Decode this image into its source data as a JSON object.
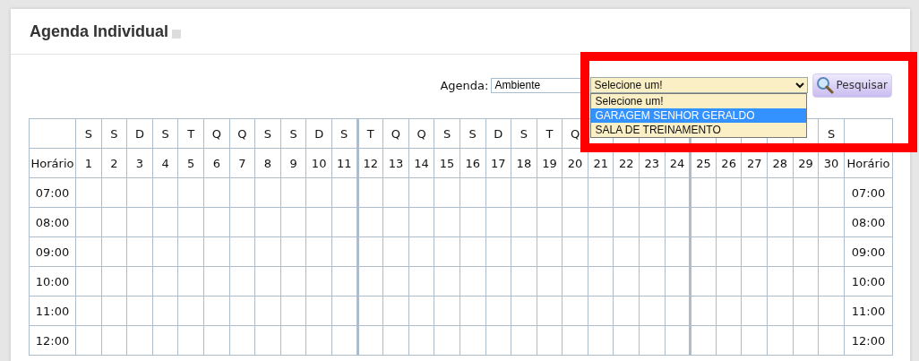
{
  "title": "Agenda Individual",
  "filter": {
    "label": "Agenda:",
    "type_value": "Ambiente",
    "select_value": "Selecione um!",
    "expanded": true,
    "options": [
      {
        "label": "Selecione um!",
        "selected": false
      },
      {
        "label": "GARAGEM SENHOR GERALDO",
        "selected": true
      },
      {
        "label": "SALA DE TREINAMENTO",
        "selected": false
      }
    ],
    "search_button": "Pesquisar"
  },
  "table": {
    "corner_label": "Horário",
    "end_label": "Horário",
    "days": [
      {
        "weekday": "S",
        "day": "1"
      },
      {
        "weekday": "S",
        "day": "2"
      },
      {
        "weekday": "D",
        "day": "3"
      },
      {
        "weekday": "S",
        "day": "4"
      },
      {
        "weekday": "T",
        "day": "5"
      },
      {
        "weekday": "Q",
        "day": "6"
      },
      {
        "weekday": "Q",
        "day": "7"
      },
      {
        "weekday": "S",
        "day": "8"
      },
      {
        "weekday": "S",
        "day": "9"
      },
      {
        "weekday": "D",
        "day": "10"
      },
      {
        "weekday": "S",
        "day": "11"
      },
      {
        "weekday": "T",
        "day": "12",
        "divider_before": true
      },
      {
        "weekday": "Q",
        "day": "13"
      },
      {
        "weekday": "Q",
        "day": "14"
      },
      {
        "weekday": "S",
        "day": "15"
      },
      {
        "weekday": "S",
        "day": "16"
      },
      {
        "weekday": "D",
        "day": "17"
      },
      {
        "weekday": "S",
        "day": "18"
      },
      {
        "weekday": "T",
        "day": "19"
      },
      {
        "weekday": "Q",
        "day": "20"
      },
      {
        "day": "21"
      },
      {
        "day": "22"
      },
      {
        "day": "23"
      },
      {
        "day": "24"
      },
      {
        "day": "25",
        "divider_before": true
      },
      {
        "day": "26"
      },
      {
        "day": "27"
      },
      {
        "day": "28"
      },
      {
        "day": "29"
      },
      {
        "weekday": "S",
        "day": "30"
      }
    ],
    "hours": [
      {
        "left": "07:00",
        "right": "07:00"
      },
      {
        "left": "08:00",
        "right": "08:00"
      },
      {
        "left": "09:00",
        "right": "09:00"
      },
      {
        "left": "10:00",
        "right": "10:00"
      },
      {
        "left": "11:00",
        "right": "11:00"
      },
      {
        "left": "12:00",
        "right": "12:00"
      }
    ]
  },
  "highlight_frame": true
}
